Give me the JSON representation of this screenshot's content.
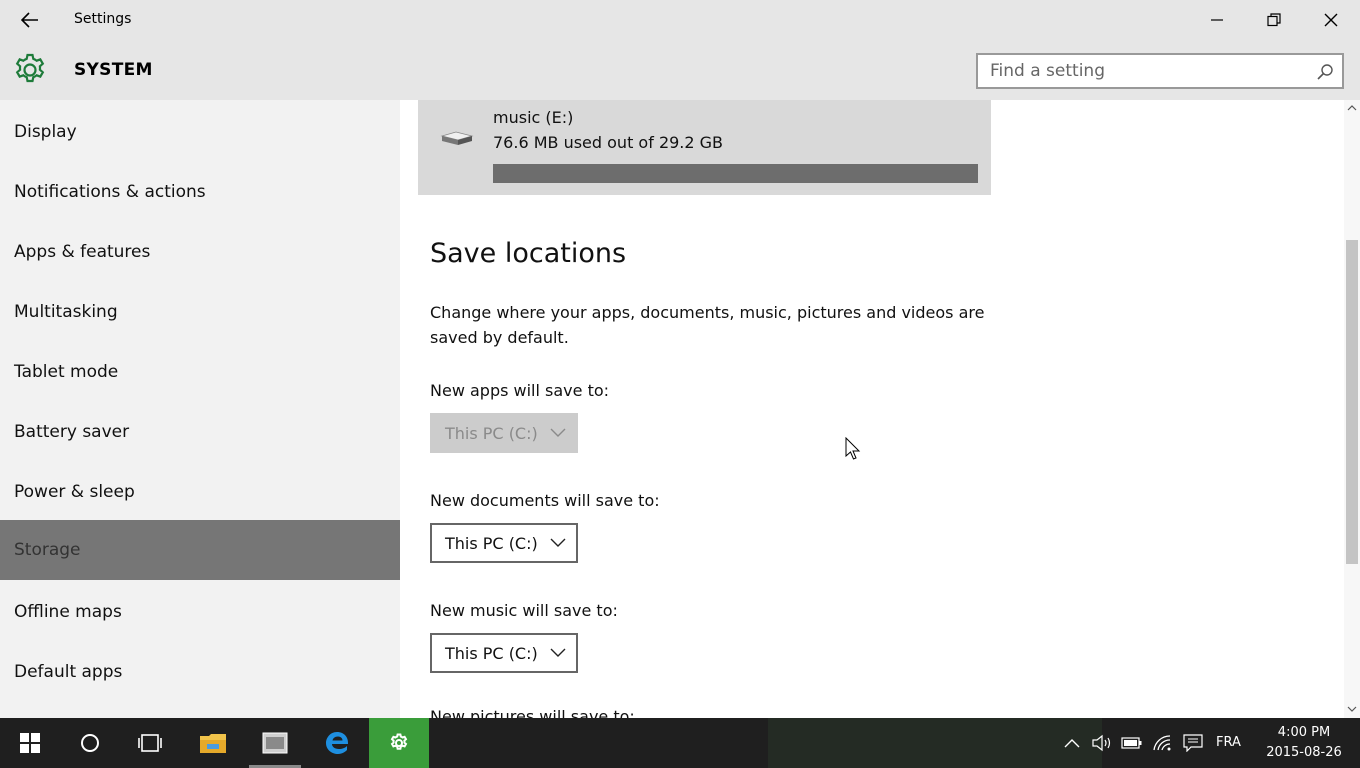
{
  "window": {
    "title": "Settings"
  },
  "header": {
    "title": "SYSTEM",
    "search_placeholder": "Find a setting"
  },
  "sidebar": {
    "items": [
      {
        "label": "Display",
        "active": false
      },
      {
        "label": "Notifications & actions",
        "active": false
      },
      {
        "label": "Apps & features",
        "active": false
      },
      {
        "label": "Multitasking",
        "active": false
      },
      {
        "label": "Tablet mode",
        "active": false
      },
      {
        "label": "Battery saver",
        "active": false
      },
      {
        "label": "Power & sleep",
        "active": false
      },
      {
        "label": "Storage",
        "active": true
      },
      {
        "label": "Offline maps",
        "active": false
      },
      {
        "label": "Default apps",
        "active": false
      }
    ]
  },
  "drive": {
    "name": "music (E:)",
    "usage": "76.6 MB used out of 29.2 GB",
    "used_fraction": 1.0
  },
  "save_locations": {
    "title": "Save locations",
    "description": "Change where your apps, documents, music, pictures and videos are saved by default.",
    "apps_label": "New apps will save to:",
    "apps_value": "This PC (C:)",
    "documents_label": "New documents will save to:",
    "documents_value": "This PC (C:)",
    "music_label": "New music will save to:",
    "music_value": "This PC (C:)",
    "pictures_label": "New pictures will save to:"
  },
  "taskbar": {
    "language": "FRA",
    "time": "4:00 PM",
    "date": "2015-08-26"
  },
  "colors": {
    "accent": "#3a9d3a",
    "selected_nav": "#767676",
    "taskbar": "#1f1f1f"
  }
}
